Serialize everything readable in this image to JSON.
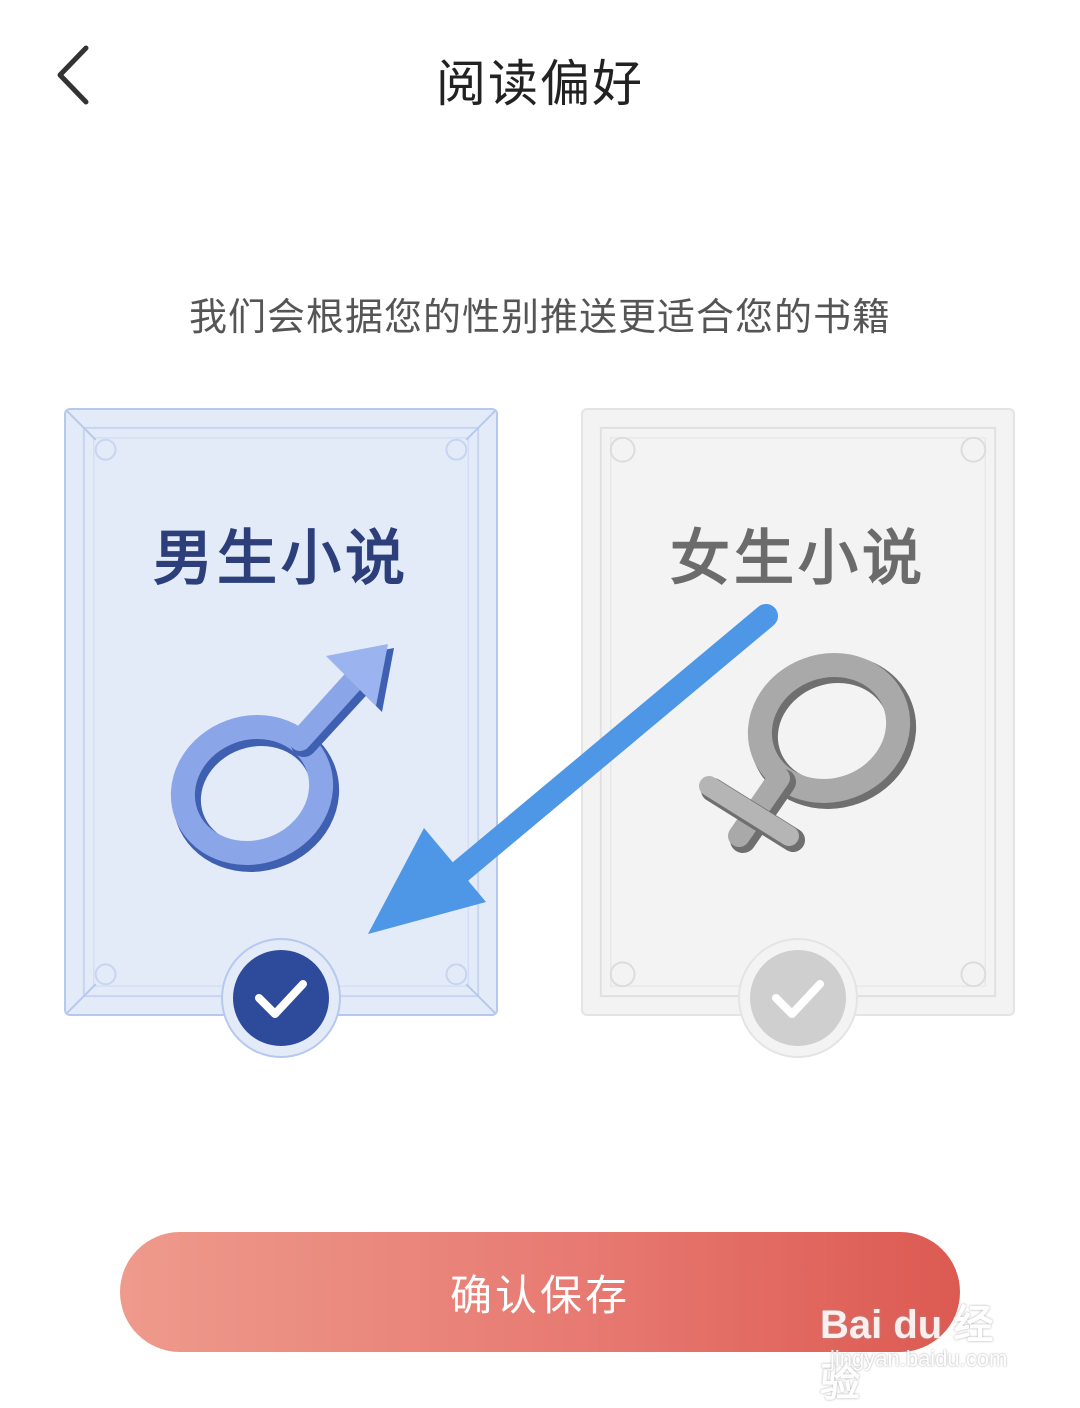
{
  "header": {
    "title": "阅读偏好",
    "back_icon": "chevron-left-icon"
  },
  "subtitle": "我们会根据您的性别推送更适合您的书籍",
  "cards": [
    {
      "label": "男生小说",
      "symbol_icon": "male-symbol-icon",
      "selected": true,
      "accent": "#2e4b9b"
    },
    {
      "label": "女生小说",
      "symbol_icon": "female-symbol-icon",
      "selected": false,
      "accent": "#cfcfcf"
    }
  ],
  "confirm_button": {
    "label": "确认保存"
  },
  "watermark": {
    "brand": "Bai du 经验",
    "url": "jingyan.baidu.com"
  },
  "colors": {
    "arrow": "#4e96e6",
    "button_start": "#ee9a8c",
    "button_end": "#dc5a52"
  }
}
